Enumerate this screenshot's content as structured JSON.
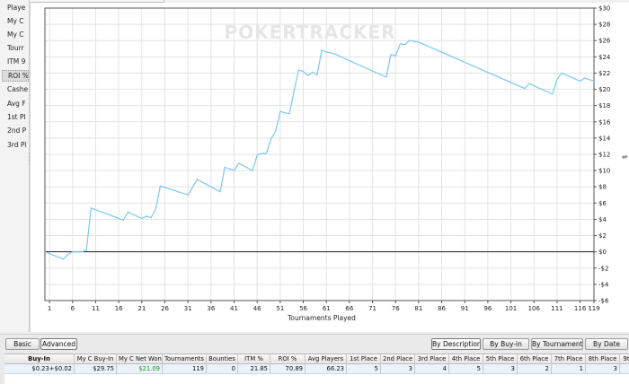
{
  "sidebar": {
    "items": [
      {
        "label": "Playe",
        "selected": false
      },
      {
        "label": "My C",
        "selected": false
      },
      {
        "label": "My C",
        "selected": false
      },
      {
        "label": "Tourr",
        "selected": false
      },
      {
        "label": "ITM 9",
        "selected": false
      },
      {
        "label": "ROI %",
        "selected": true
      },
      {
        "label": "Cashe",
        "selected": false
      },
      {
        "label": "Avg F",
        "selected": false
      },
      {
        "label": "1st Pl",
        "selected": false
      },
      {
        "label": "2nd P",
        "selected": false
      },
      {
        "label": "3rd Pl",
        "selected": false
      }
    ]
  },
  "chart_data": {
    "type": "line",
    "watermark": "POKERTRACKER",
    "xlabel": "Tournaments Played",
    "ylabel": "$",
    "xlim": [
      0,
      119
    ],
    "ylim": [
      -6,
      30
    ],
    "x_ticks": [
      1,
      6,
      11,
      16,
      21,
      26,
      31,
      36,
      41,
      46,
      51,
      56,
      61,
      66,
      71,
      76,
      81,
      86,
      91,
      96,
      101,
      106,
      111,
      116,
      119
    ],
    "y_ticks": [
      30,
      28,
      26,
      24,
      22,
      20,
      18,
      16,
      14,
      12,
      10,
      8,
      6,
      4,
      2,
      0,
      -2,
      -4,
      -6
    ],
    "y_tick_labels": [
      "$30",
      "$28",
      "$26",
      "$24",
      "$22",
      "$20",
      "$18",
      "$16",
      "$14",
      "$12",
      "$10",
      "$8",
      "$6",
      "$4",
      "$2",
      "$0",
      "-$2",
      "-$4",
      "-$6"
    ],
    "grid": true,
    "zero_line": true,
    "line_color": "#7cc8ee",
    "series": [
      {
        "x": [
          0,
          4,
          5,
          6,
          7,
          8,
          9,
          10,
          17,
          18,
          21,
          22,
          23,
          24,
          25,
          31,
          33,
          38,
          39,
          40,
          41,
          42,
          45,
          46,
          47,
          48,
          49,
          50,
          51,
          52,
          53,
          54,
          55,
          56,
          57,
          58,
          59,
          60,
          61,
          62,
          63,
          74,
          75,
          76,
          77,
          78,
          79,
          80,
          81,
          104,
          105,
          110,
          111,
          112,
          116,
          117,
          119
        ],
        "y": [
          0,
          -0.9,
          -0.3,
          0,
          0,
          0,
          0.2,
          5.4,
          3.9,
          4.9,
          4.1,
          4.4,
          4.2,
          5.2,
          8.1,
          7.0,
          8.9,
          7.4,
          10.4,
          10.2,
          10.0,
          10.9,
          10.0,
          11.9,
          12.1,
          12.1,
          13.9,
          14.8,
          17.3,
          17.1,
          17.0,
          19.8,
          22.4,
          22.2,
          21.7,
          22.1,
          21.8,
          24.8,
          24.6,
          24.5,
          24.3,
          21.5,
          24.3,
          24.1,
          25.6,
          25.5,
          26.0,
          25.9,
          25.8,
          20.1,
          20.7,
          19.4,
          21.2,
          22.0,
          21.0,
          21.4,
          21.0
        ]
      }
    ]
  },
  "bottom": {
    "left_buttons": [
      "Basic",
      "Advanced"
    ],
    "right_buttons": [
      "By Description",
      "By Buy-in",
      "By Tournament",
      "By Date"
    ],
    "table": {
      "headers": [
        "Buy-In",
        "My C Buy-In",
        "My C Net Won",
        "Tournaments",
        "Bounties",
        "ITM %",
        "ROI %",
        "Avg Players",
        "1st Place",
        "2nd Place",
        "3rd Place",
        "4th Place",
        "5th Place",
        "6th Place",
        "7th Place",
        "8th Place",
        "9t"
      ],
      "rows": [
        [
          "$0.23+$0.02",
          "$29.75",
          "$21.09",
          "119",
          "0",
          "21.85",
          "70.89",
          "66.23",
          "5",
          "3",
          "4",
          "5",
          "3",
          "2",
          "1",
          "3",
          ""
        ]
      ],
      "positive_color": "#1a9a1a"
    }
  }
}
